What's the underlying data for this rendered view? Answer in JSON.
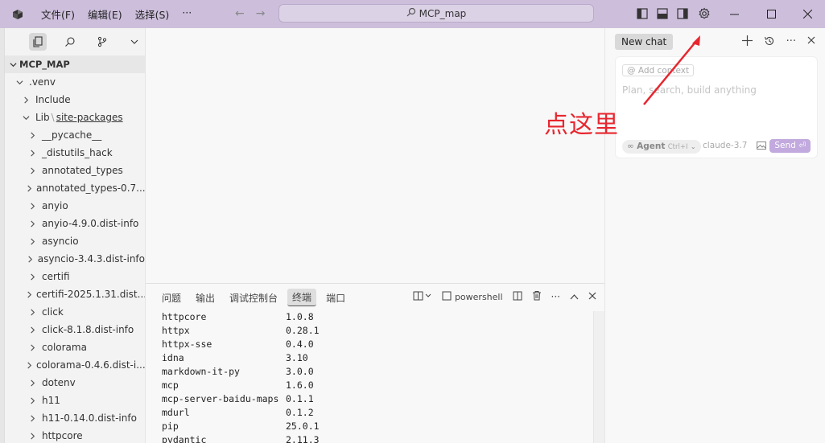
{
  "titlebar": {
    "menu": [
      "文件(F)",
      "编辑(E)",
      "选择(S)",
      "···"
    ],
    "search_text": "MCP_map"
  },
  "sidebar": {
    "root": "MCP_MAP",
    "tree": [
      {
        "label": ".venv",
        "depth": 0,
        "open": true
      },
      {
        "label": "Include",
        "depth": 1,
        "open": false
      },
      {
        "label": "Lib",
        "depth": 1,
        "open": true,
        "suffix": "site-packages"
      },
      {
        "label": "__pycache__",
        "depth": 2,
        "open": false
      },
      {
        "label": "_distutils_hack",
        "depth": 2,
        "open": false
      },
      {
        "label": "annotated_types",
        "depth": 2,
        "open": false
      },
      {
        "label": "annotated_types-0.7...",
        "depth": 2,
        "open": false
      },
      {
        "label": "anyio",
        "depth": 2,
        "open": false
      },
      {
        "label": "anyio-4.9.0.dist-info",
        "depth": 2,
        "open": false
      },
      {
        "label": "asyncio",
        "depth": 2,
        "open": false
      },
      {
        "label": "asyncio-3.4.3.dist-info",
        "depth": 2,
        "open": false
      },
      {
        "label": "certifi",
        "depth": 2,
        "open": false
      },
      {
        "label": "certifi-2025.1.31.dist...",
        "depth": 2,
        "open": false
      },
      {
        "label": "click",
        "depth": 2,
        "open": false
      },
      {
        "label": "click-8.1.8.dist-info",
        "depth": 2,
        "open": false
      },
      {
        "label": "colorama",
        "depth": 2,
        "open": false
      },
      {
        "label": "colorama-0.4.6.dist-i...",
        "depth": 2,
        "open": false
      },
      {
        "label": "dotenv",
        "depth": 2,
        "open": false
      },
      {
        "label": "h11",
        "depth": 2,
        "open": false
      },
      {
        "label": "h11-0.14.0.dist-info",
        "depth": 2,
        "open": false
      },
      {
        "label": "httpcore",
        "depth": 2,
        "open": false
      }
    ]
  },
  "panel": {
    "tabs": [
      "问题",
      "输出",
      "调试控制台",
      "终端",
      "端口"
    ],
    "active_tab": "终端",
    "shell_label": "powershell",
    "packages": [
      {
        "name": "httpcore",
        "version": "1.0.8"
      },
      {
        "name": "httpx",
        "version": "0.28.1"
      },
      {
        "name": "httpx-sse",
        "version": "0.4.0"
      },
      {
        "name": "idna",
        "version": "3.10"
      },
      {
        "name": "markdown-it-py",
        "version": "3.0.0"
      },
      {
        "name": "mcp",
        "version": "1.6.0"
      },
      {
        "name": "mcp-server-baidu-maps",
        "version": "0.1.1"
      },
      {
        "name": "mdurl",
        "version": "0.1.2"
      },
      {
        "name": "pip",
        "version": "25.0.1"
      },
      {
        "name": "pydantic",
        "version": "2.11.3"
      }
    ]
  },
  "chat": {
    "new_chat": "New chat",
    "add_context": "Add context",
    "placeholder": "Plan, search, build anything",
    "agent_label": "Agent",
    "agent_shortcut": "Ctrl+I",
    "model": "claude-3.7",
    "send": "Send"
  },
  "annotation": {
    "text": "点这里",
    "color": "#e8262f"
  }
}
